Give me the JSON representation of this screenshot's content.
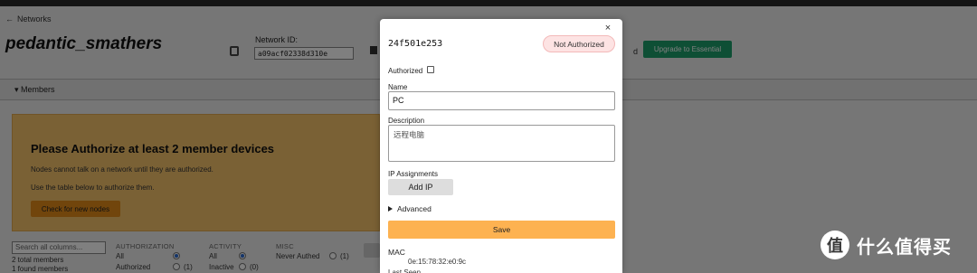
{
  "background": {
    "back_link": "Networks",
    "network_name": "pedantic_smathers",
    "network_id_label": "Network ID:",
    "network_id": "a09acf02338d310e",
    "right_partial": "d",
    "upgrade_button": "Upgrade to Essential",
    "members_section": "Members",
    "authorize": {
      "title": "Please Authorize at least 2 member devices",
      "line1": "Nodes cannot talk on a network until they are authorized.",
      "line2": "Use the table below to authorize them.",
      "button": "Check for new nodes"
    },
    "search_placeholder": "Search all columns...",
    "total_members": "2 total members",
    "found_members": "1 found members",
    "filters": {
      "authorization": {
        "heading": "AUTHORIZATION",
        "all": "All",
        "authorized": "Authorized",
        "authorized_count": "(1)"
      },
      "activity": {
        "heading": "ACTIVITY",
        "all": "All",
        "inactive": "Inactive",
        "inactive_count": "(0)"
      },
      "misc": {
        "heading": "MISC",
        "never_authed": "Never Authed",
        "never_authed_count": "(1)"
      }
    }
  },
  "modal": {
    "node_id": "24f501e253",
    "status": "Not Authorized",
    "authorized_label": "Authorized",
    "authorized_checked": false,
    "name_label": "Name",
    "name_value": "PC",
    "description_label": "Description",
    "description_value": "远程电脑",
    "ip_label": "IP Assignments",
    "add_ip": "Add IP",
    "advanced": "Advanced",
    "save": "Save",
    "mac_label": "MAC",
    "mac_value": "0e:15:78:32:e0:9c",
    "last_seen_label": "Last Seen"
  },
  "watermark": {
    "logo_char": "值",
    "text": "什么值得买"
  },
  "colors": {
    "upgrade": "#1d9e6b",
    "authorize_bg": "#f5c26b",
    "save": "#fdb251",
    "status_pill": "#fde3e3"
  }
}
